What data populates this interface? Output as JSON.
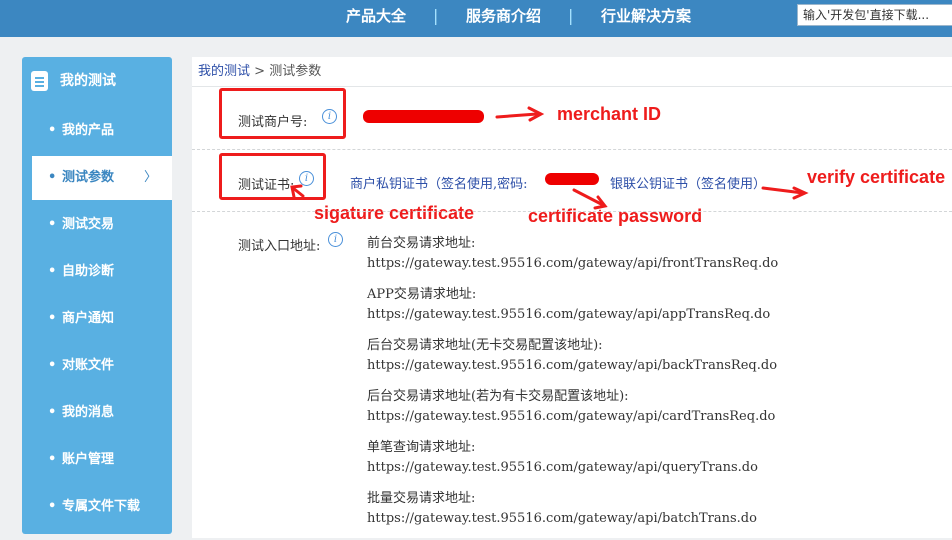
{
  "topnav": {
    "items": [
      "产品大全",
      "服务商介绍",
      "行业解决方案"
    ],
    "separator": "|",
    "search_placeholder": "输入'开发包'直接下载..."
  },
  "sidebar": {
    "title": "我的测试",
    "items": [
      {
        "label": "我的产品"
      },
      {
        "label": "测试参数",
        "active": true
      },
      {
        "label": "测试交易"
      },
      {
        "label": "自助诊断"
      },
      {
        "label": "商户通知"
      },
      {
        "label": "对账文件"
      },
      {
        "label": "我的消息"
      },
      {
        "label": "账户管理"
      },
      {
        "label": "专属文件下载"
      }
    ],
    "bullet": "•",
    "active_chevron": "〉"
  },
  "breadcrumb": {
    "parent": "我的测试",
    "separator": " > ",
    "current": "测试参数"
  },
  "merchant": {
    "label": "测试商户号:"
  },
  "certificate": {
    "label": "测试证书:",
    "private_key_prefix": "商户私钥证书（签名使用,密码:",
    "public_key_link": "银联公钥证书（签名使用）"
  },
  "endpoints": {
    "label": "测试入口地址:",
    "items": [
      {
        "title": "前台交易请求地址:",
        "url": "https://gateway.test.95516.com/gateway/api/frontTransReq.do"
      },
      {
        "title": "APP交易请求地址:",
        "url": "https://gateway.test.95516.com/gateway/api/appTransReq.do"
      },
      {
        "title": "后台交易请求地址(无卡交易配置该地址):",
        "url": "https://gateway.test.95516.com/gateway/api/backTransReq.do"
      },
      {
        "title": "后台交易请求地址(若为有卡交易配置该地址):",
        "url": "https://gateway.test.95516.com/gateway/api/cardTransReq.do"
      },
      {
        "title": "单笔查询请求地址:",
        "url": "https://gateway.test.95516.com/gateway/api/queryTrans.do"
      },
      {
        "title": "批量交易请求地址:",
        "url": "https://gateway.test.95516.com/gateway/api/batchTrans.do"
      }
    ]
  },
  "annotations": {
    "merchant_id": "merchant ID",
    "verify_certificate": "verify certificate",
    "signature_certificate": "sigature certificate",
    "certificate_password": "certificate password"
  },
  "info_glyph": "i",
  "colors": {
    "nav": "#3c87c1",
    "sidebar": "#59b0e2",
    "link": "#2d4fa8",
    "annotation": "#ee1c1c"
  }
}
